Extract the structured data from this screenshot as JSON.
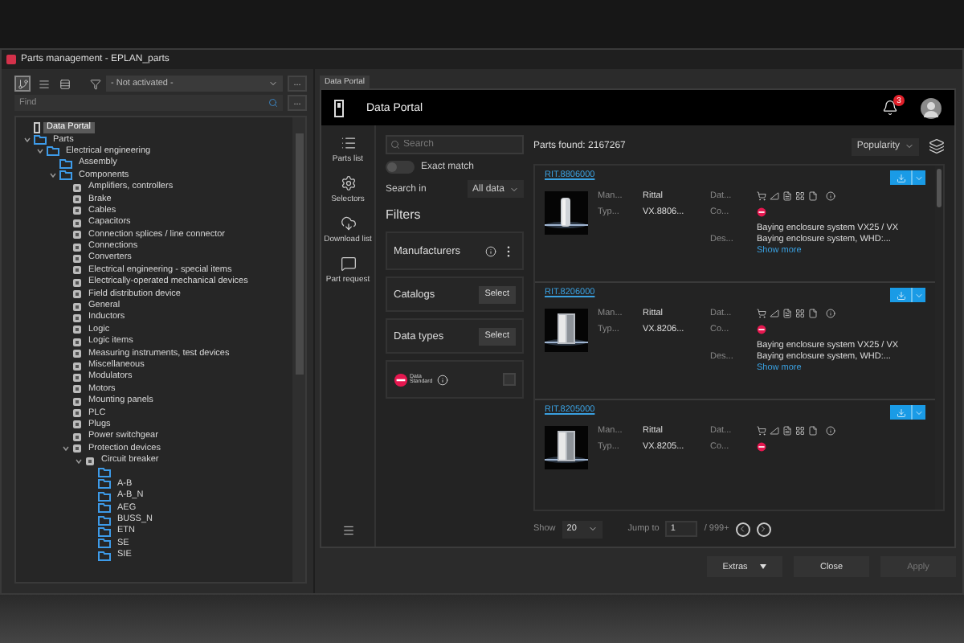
{
  "window": {
    "title": "Parts management - EPLAN_parts"
  },
  "left": {
    "view_buttons": [
      {
        "selected": true
      },
      {
        "selected": false
      },
      {
        "selected": false
      }
    ],
    "filter": {
      "value": "- Not activated -"
    },
    "filter_more": "...",
    "find": {
      "placeholder": "Find"
    },
    "find_more": "...",
    "tree": [
      {
        "label": "Data Portal",
        "kind": "portal",
        "selected": true
      },
      {
        "label": "Parts",
        "kind": "folder",
        "selected": false,
        "expanded": true,
        "children": [
          {
            "label": "Electrical engineering",
            "kind": "folder",
            "selected": false,
            "expanded": true,
            "children": [
              {
                "label": "Assembly",
                "kind": "folder",
                "selected": false
              },
              {
                "label": "Components",
                "kind": "folder",
                "selected": false,
                "expanded": true,
                "children": [
                  {
                    "label": "Amplifiers, controllers",
                    "kind": "item",
                    "selected": false
                  },
                  {
                    "label": "Brake",
                    "kind": "item",
                    "selected": false
                  },
                  {
                    "label": "Cables",
                    "kind": "item",
                    "selected": false
                  },
                  {
                    "label": "Capacitors",
                    "kind": "item",
                    "selected": false
                  },
                  {
                    "label": "Connection splices / line connector",
                    "kind": "item",
                    "selected": false
                  },
                  {
                    "label": "Connections",
                    "kind": "item",
                    "selected": false
                  },
                  {
                    "label": "Converters",
                    "kind": "item",
                    "selected": false
                  },
                  {
                    "label": "Electrical engineering - special items",
                    "kind": "item",
                    "selected": false
                  },
                  {
                    "label": "Electrically-operated mechanical devices",
                    "kind": "item",
                    "selected": false
                  },
                  {
                    "label": "Field distribution device",
                    "kind": "item",
                    "selected": false
                  },
                  {
                    "label": "General",
                    "kind": "item",
                    "selected": false
                  },
                  {
                    "label": "Inductors",
                    "kind": "item",
                    "selected": false
                  },
                  {
                    "label": "Logic",
                    "kind": "item",
                    "selected": false
                  },
                  {
                    "label": "Logic items",
                    "kind": "item",
                    "selected": false
                  },
                  {
                    "label": "Measuring instruments, test devices",
                    "kind": "item",
                    "selected": false
                  },
                  {
                    "label": "Miscellaneous",
                    "kind": "item",
                    "selected": false
                  },
                  {
                    "label": "Modulators",
                    "kind": "item",
                    "selected": false
                  },
                  {
                    "label": "Motors",
                    "kind": "item",
                    "selected": false
                  },
                  {
                    "label": "Mounting panels",
                    "kind": "item",
                    "selected": false
                  },
                  {
                    "label": "PLC",
                    "kind": "item",
                    "selected": false
                  },
                  {
                    "label": "Plugs",
                    "kind": "item",
                    "selected": false
                  },
                  {
                    "label": "Power switchgear",
                    "kind": "item",
                    "selected": false
                  },
                  {
                    "label": "Protection devices",
                    "kind": "item",
                    "selected": false,
                    "expanded": true,
                    "children": [
                      {
                        "label": "Circuit breaker",
                        "kind": "item",
                        "selected": false,
                        "expanded": true,
                        "children": [
                          {
                            "kind": "folder",
                            "selected": false
                          },
                          {
                            "label": "A-B",
                            "kind": "folder",
                            "selected": false
                          },
                          {
                            "label": "A-B_N",
                            "kind": "folder",
                            "selected": false
                          },
                          {
                            "label": "AEG",
                            "kind": "folder",
                            "selected": false
                          },
                          {
                            "label": "BUSS_N",
                            "kind": "folder",
                            "selected": false
                          },
                          {
                            "label": "ETN",
                            "kind": "folder",
                            "selected": false
                          },
                          {
                            "label": "SE",
                            "kind": "folder",
                            "selected": false
                          },
                          {
                            "label": "SIE",
                            "kind": "folder",
                            "selected": false
                          }
                        ]
                      }
                    ]
                  }
                ]
              }
            ]
          }
        ]
      }
    ]
  },
  "portal": {
    "tab": "Data Portal",
    "title": "Data Portal",
    "notifications": "3",
    "nav": [
      {
        "label": "Parts list",
        "kind": "list"
      },
      {
        "label": "Selectors",
        "kind": "selector"
      },
      {
        "label": "Download list",
        "kind": "download"
      },
      {
        "label": "Part request",
        "kind": "request"
      }
    ],
    "search": {
      "placeholder": "Search"
    },
    "exact_match": {
      "label": "Exact match",
      "on": false
    },
    "search_in": {
      "label": "Search in",
      "value": "All data"
    },
    "filters_title": "Filters",
    "filters": [
      {
        "kind": "menu",
        "label": "Manufacturers"
      },
      {
        "kind": "select",
        "label": "Catalogs",
        "button": "Select"
      },
      {
        "kind": "select",
        "label": "Data types",
        "button": "Select"
      },
      {
        "kind": "standard",
        "label": "Data Standard",
        "checked": false
      }
    ],
    "results": {
      "count": "Parts found: 2167267",
      "sort": "Popularity",
      "parts": [
        {
          "number": "RIT.8806000",
          "manufacturer_label": "Man...",
          "manufacturer": "Rittal",
          "type_label": "Typ...",
          "type": "VX.8806...",
          "data_label": "Dat...",
          "company_label": "Co...",
          "description_label": "Des...",
          "description": [
            "Baying enclosure system VX25 / VX",
            "Baying enclosure system, WHD:..."
          ],
          "show_more": "Show more"
        },
        {
          "number": "RIT.8206000",
          "manufacturer_label": "Man...",
          "manufacturer": "Rittal",
          "type_label": "Typ...",
          "type": "VX.8206...",
          "data_label": "Dat...",
          "company_label": "Co...",
          "description_label": "Des...",
          "description": [
            "Baying enclosure system VX25 / VX",
            "Baying enclosure system, WHD:..."
          ],
          "show_more": "Show more"
        },
        {
          "number": "RIT.8205000",
          "manufacturer_label": "Man...",
          "manufacturer": "Rittal",
          "type_label": "Typ...",
          "type": "VX.8205...",
          "data_label": "Dat...",
          "company_label": "Co..."
        }
      ],
      "pager": {
        "show_label": "Show",
        "page_size": "20",
        "jump_label": "Jump to",
        "page": "1",
        "total": "/ 999+"
      }
    }
  },
  "buttons": [
    {
      "label": "Extras",
      "kind": "menu",
      "disabled": false
    },
    {
      "label": "Close",
      "kind": "plain",
      "disabled": false
    },
    {
      "label": "Apply",
      "kind": "plain",
      "disabled": true
    }
  ]
}
